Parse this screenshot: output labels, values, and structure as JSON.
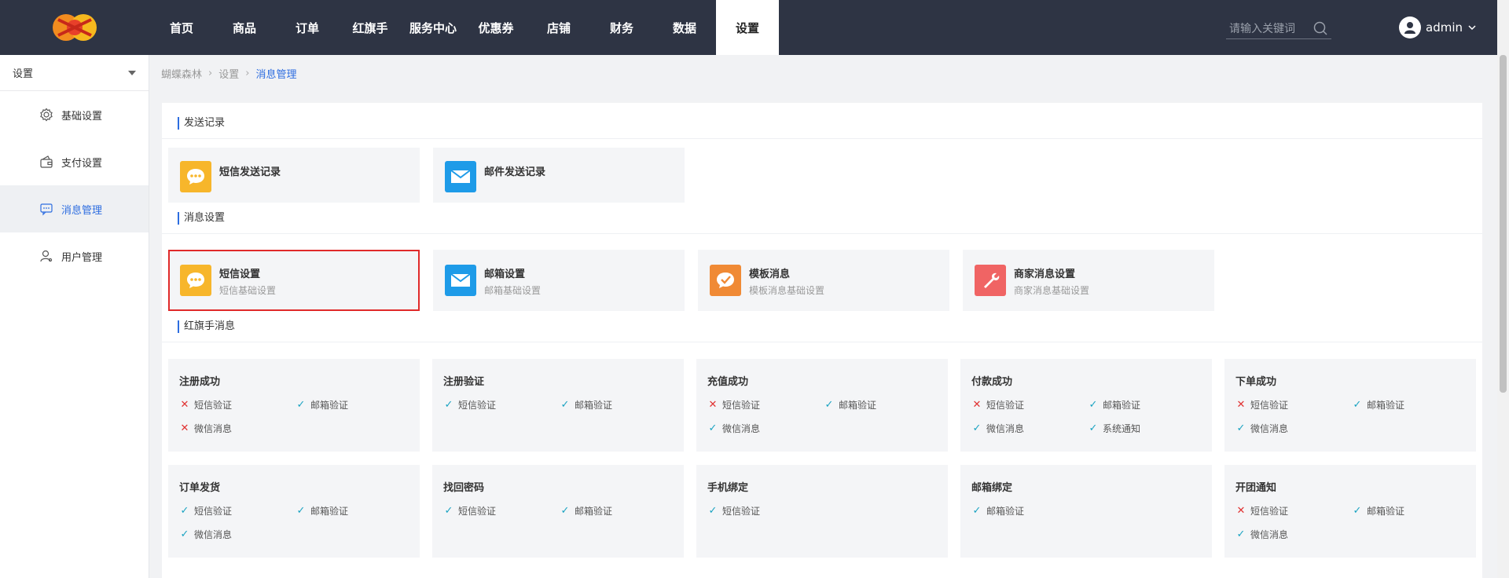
{
  "nav": {
    "items": [
      "首页",
      "商品",
      "订单",
      "红旗手",
      "服务中心",
      "优惠券",
      "店铺",
      "财务",
      "数据",
      "设置"
    ],
    "active_index": 9
  },
  "search": {
    "placeholder": "请输入关键词"
  },
  "user": {
    "name": "admin"
  },
  "sidebar": {
    "select_label": "设置",
    "items": [
      {
        "label": "基础设置",
        "icon": "gear-icon"
      },
      {
        "label": "支付设置",
        "icon": "wallet-icon"
      },
      {
        "label": "消息管理",
        "icon": "message-icon"
      },
      {
        "label": "用户管理",
        "icon": "user-icon"
      }
    ],
    "active_index": 2
  },
  "breadcrumb": [
    "蝴蝶森林",
    "设置",
    "消息管理"
  ],
  "sections": {
    "send_records": "发送记录",
    "message_settings": "消息设置",
    "hongqishou": "红旗手消息"
  },
  "send_records": [
    {
      "title": "短信发送记录",
      "icon": "chat-icon",
      "color": "#f7b62b"
    },
    {
      "title": "邮件发送记录",
      "icon": "mail-icon",
      "color": "#1e9be8"
    }
  ],
  "message_settings": [
    {
      "title": "短信设置",
      "subtitle": "短信基础设置",
      "icon": "chat-icon",
      "color": "#f7b62b",
      "selected": true
    },
    {
      "title": "邮箱设置",
      "subtitle": "邮箱基础设置",
      "icon": "mail-icon",
      "color": "#1e9be8"
    },
    {
      "title": "模板消息",
      "subtitle": "模板消息基础设置",
      "icon": "wechat-check-icon",
      "color": "#f08a35"
    },
    {
      "title": "商家消息设置",
      "subtitle": "商家消息基础设置",
      "icon": "wrench-icon",
      "color": "#f06464"
    }
  ],
  "messages": [
    {
      "title": "注册成功",
      "checks": [
        [
          "短信验证",
          false
        ],
        [
          "邮箱验证",
          true
        ],
        [
          "微信消息",
          false
        ]
      ]
    },
    {
      "title": "注册验证",
      "checks": [
        [
          "短信验证",
          true
        ],
        [
          "邮箱验证",
          true
        ]
      ]
    },
    {
      "title": "充值成功",
      "checks": [
        [
          "短信验证",
          false
        ],
        [
          "邮箱验证",
          true
        ],
        [
          "微信消息",
          true
        ]
      ]
    },
    {
      "title": "付款成功",
      "checks": [
        [
          "短信验证",
          false
        ],
        [
          "邮箱验证",
          true
        ],
        [
          "微信消息",
          true
        ],
        [
          "系统通知",
          true
        ]
      ]
    },
    {
      "title": "下单成功",
      "checks": [
        [
          "短信验证",
          false
        ],
        [
          "邮箱验证",
          true
        ],
        [
          "微信消息",
          true
        ]
      ]
    },
    {
      "title": "订单发货",
      "checks": [
        [
          "短信验证",
          true
        ],
        [
          "邮箱验证",
          true
        ],
        [
          "微信消息",
          true
        ]
      ]
    },
    {
      "title": "找回密码",
      "checks": [
        [
          "短信验证",
          true
        ],
        [
          "邮箱验证",
          true
        ]
      ]
    },
    {
      "title": "手机绑定",
      "checks": [
        [
          "短信验证",
          true
        ]
      ]
    },
    {
      "title": "邮箱绑定",
      "checks": [
        [
          "邮箱验证",
          true
        ]
      ]
    },
    {
      "title": "开团通知",
      "checks": [
        [
          "短信验证",
          false
        ],
        [
          "邮箱验证",
          true
        ],
        [
          "微信消息",
          true
        ]
      ]
    }
  ],
  "colors": {
    "accent": "#2d6de0",
    "topbar": "#2e3444",
    "check_on": "#1aa3c2",
    "check_off": "#e03232",
    "selected_border": "#e02a2a"
  }
}
